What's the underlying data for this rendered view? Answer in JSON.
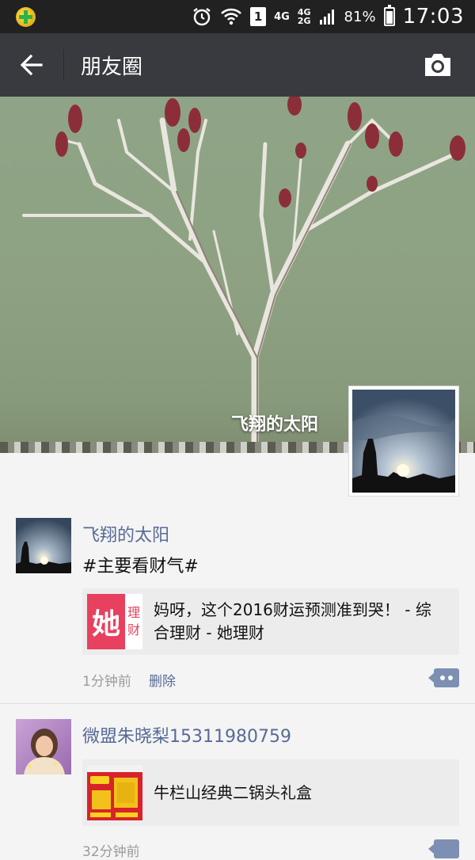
{
  "status_bar": {
    "sim_slot": "1",
    "network_a": "4G",
    "network_b_top": "4G",
    "network_b_bottom": "2G",
    "battery_percent": "81%",
    "battery_level": 0.81,
    "time": "17:03"
  },
  "action_bar": {
    "title": "朋友圈",
    "back_icon": "arrow-left-icon",
    "camera_icon": "camera-icon"
  },
  "cover": {
    "user_name": "飞翔的太阳"
  },
  "posts": [
    {
      "author": "飞翔的太阳",
      "text": "#主要看财气#",
      "share": {
        "title": "妈呀，这个2016财运预测准到哭！ - 综合理财 - 她理财",
        "thumb_main": "她",
        "thumb_side_1": "理",
        "thumb_side_2": "财"
      },
      "time": "1分钟前",
      "delete_label": "删除"
    },
    {
      "author": "微盟朱晓梨15311980759",
      "share": {
        "title": "牛栏山经典二锅头礼盒"
      },
      "time": "32分钟前"
    }
  ],
  "colors": {
    "status_bar_bg": "#212121",
    "action_bar_bg": "#393a3f",
    "link_blue": "#576b95",
    "page_bg": "#f4f4f4",
    "share_card_bg": "#ececec",
    "brand_pink": "#e8405f"
  }
}
